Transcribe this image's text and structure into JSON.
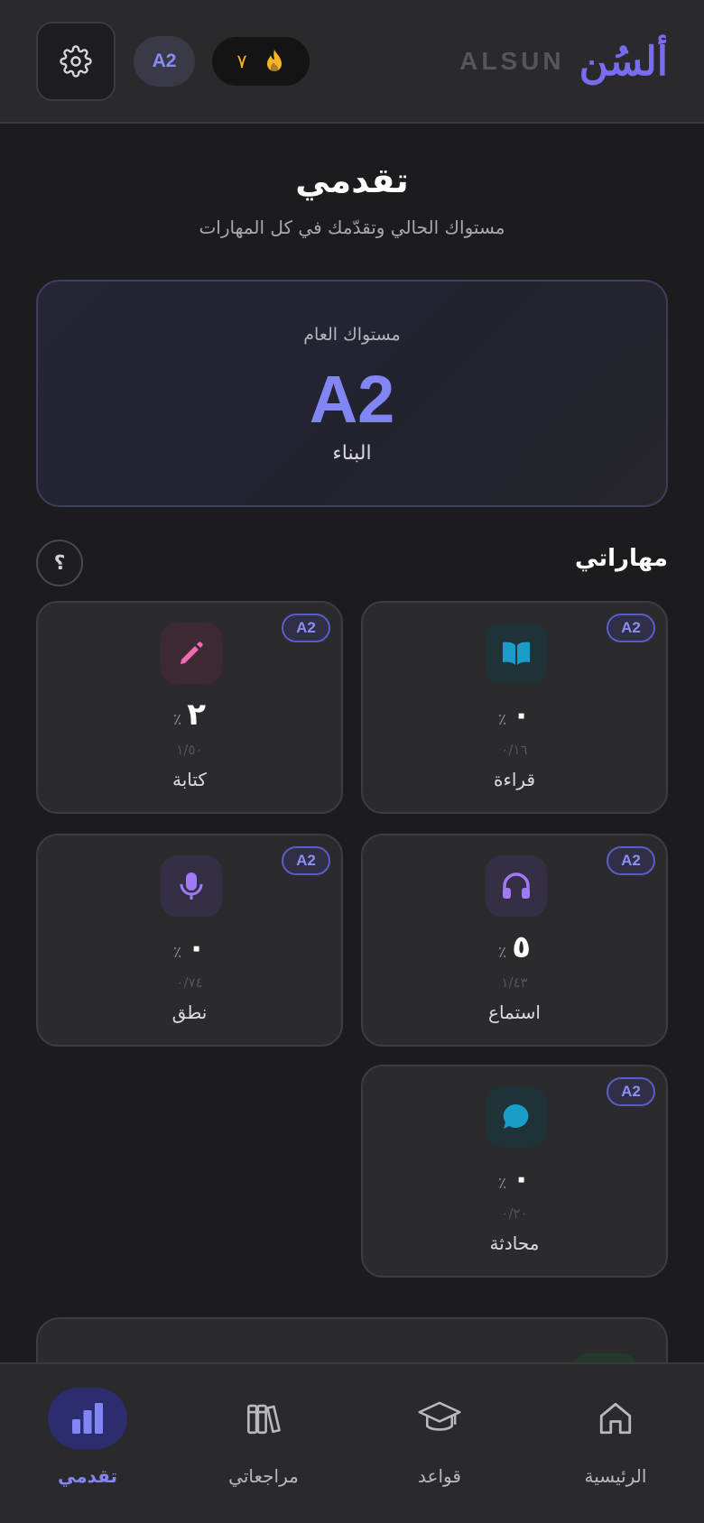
{
  "header": {
    "brand_latin": "ALSUN",
    "brand_arabic": "ألسُن",
    "level_badge": "A2",
    "streak_count": "٧",
    "settings_icon": "gear-icon",
    "streak_icon": "flame-icon"
  },
  "page": {
    "title": "تقدمي",
    "subtitle": "مستواك الحالي وتقدّمك في كل المهارات"
  },
  "overall": {
    "label": "مستواك العام",
    "level": "A2",
    "level_name": "البناء"
  },
  "skills": {
    "title": "مهاراتي",
    "help_label": "؟",
    "items": [
      {
        "name": "قراءة",
        "level": "A2",
        "percent": "٠",
        "count": "٠/١٦",
        "icon": "book-icon",
        "icon_color": "#1a9ec9",
        "icon_bg": "#1f3237"
      },
      {
        "name": "كتابة",
        "level": "A2",
        "percent": "٢",
        "count": "١/٥٠",
        "icon": "pencil-icon",
        "icon_color": "#f06ab0",
        "icon_bg": "#3d2a35"
      },
      {
        "name": "استماع",
        "level": "A2",
        "percent": "٥",
        "count": "١/٤٣",
        "icon": "headphones-icon",
        "icon_color": "#a07af5",
        "icon_bg": "#352f45"
      },
      {
        "name": "نطق",
        "level": "A2",
        "percent": "٠",
        "count": "٠/٧٤",
        "icon": "microphone-icon",
        "icon_color": "#a07af5",
        "icon_bg": "#352f45"
      },
      {
        "name": "محادثة",
        "level": "A2",
        "percent": "٠",
        "count": "٠/٢٠",
        "icon": "chat-bubble-icon",
        "icon_color": "#1a9ec9",
        "icon_bg": "#1f3237"
      }
    ],
    "percent_sign": "٪"
  },
  "nav": {
    "items": [
      {
        "label": "الرئيسية",
        "icon": "home-icon",
        "active": false
      },
      {
        "label": "قواعد",
        "icon": "graduation-cap-icon",
        "active": false
      },
      {
        "label": "مراجعاتي",
        "icon": "books-icon",
        "active": false
      },
      {
        "label": "تقدمي",
        "icon": "bar-chart-icon",
        "active": true
      }
    ]
  },
  "colors": {
    "accent": "#8285f4",
    "background": "#1c1c1e",
    "card": "#2b2b2d",
    "streak": "#f6b425"
  }
}
